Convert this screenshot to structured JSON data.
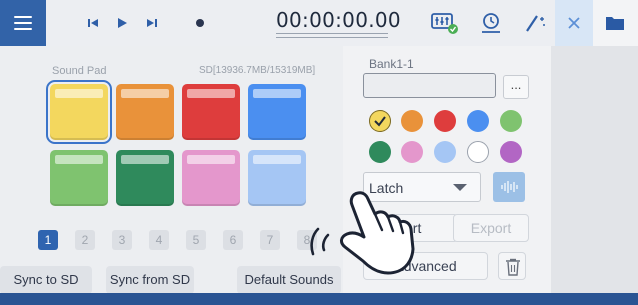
{
  "toolbar": {
    "timecode": "00:00:00.00",
    "icons": [
      "menu-icon",
      "skip-back-icon",
      "play-icon",
      "skip-forward-icon",
      "record-icon",
      "mixer-settings-icon",
      "timer-icon",
      "magic-wand-icon",
      "close-icon",
      "folder-icon"
    ]
  },
  "sound_pad": {
    "section_label": "Sound Pad",
    "sd_info": "SD[13936.7MB/15319MB]",
    "pads": [
      {
        "color": "#f3d75e",
        "selected": true
      },
      {
        "color": "#e9923a",
        "selected": false
      },
      {
        "color": "#de3d3d",
        "selected": false
      },
      {
        "color": "#4b8ff0",
        "selected": false
      },
      {
        "color": "#7fc36f",
        "selected": false
      },
      {
        "color": "#2f8a5c",
        "selected": false
      },
      {
        "color": "#e497cc",
        "selected": false
      },
      {
        "color": "#a5c6f4",
        "selected": false
      }
    ],
    "pages": [
      "1",
      "2",
      "3",
      "4",
      "5",
      "6",
      "7",
      "8"
    ],
    "active_page": "1"
  },
  "buttons": {
    "sync_to_sd": "Sync to SD",
    "sync_from_sd": "Sync from SD",
    "default_sounds": "Default Sounds"
  },
  "bank": {
    "label": "Bank1-1",
    "name_value": "",
    "more_label": "..."
  },
  "colors": {
    "swatches": [
      "#f3d75e",
      "#e9923a",
      "#de3d3d",
      "#4b8ff0",
      "#7fc36f",
      "#2f8a5c",
      "#e497cc",
      "#a5c6f4",
      "#ffffff",
      "#b266c4"
    ],
    "selected_index": 0,
    "accent": "#3263a8"
  },
  "playback": {
    "mode_value": "Latch"
  },
  "actions": {
    "import_label": "Import",
    "import_visible_text": "ort",
    "export_label": "Export",
    "advanced_label": "Advanced"
  }
}
